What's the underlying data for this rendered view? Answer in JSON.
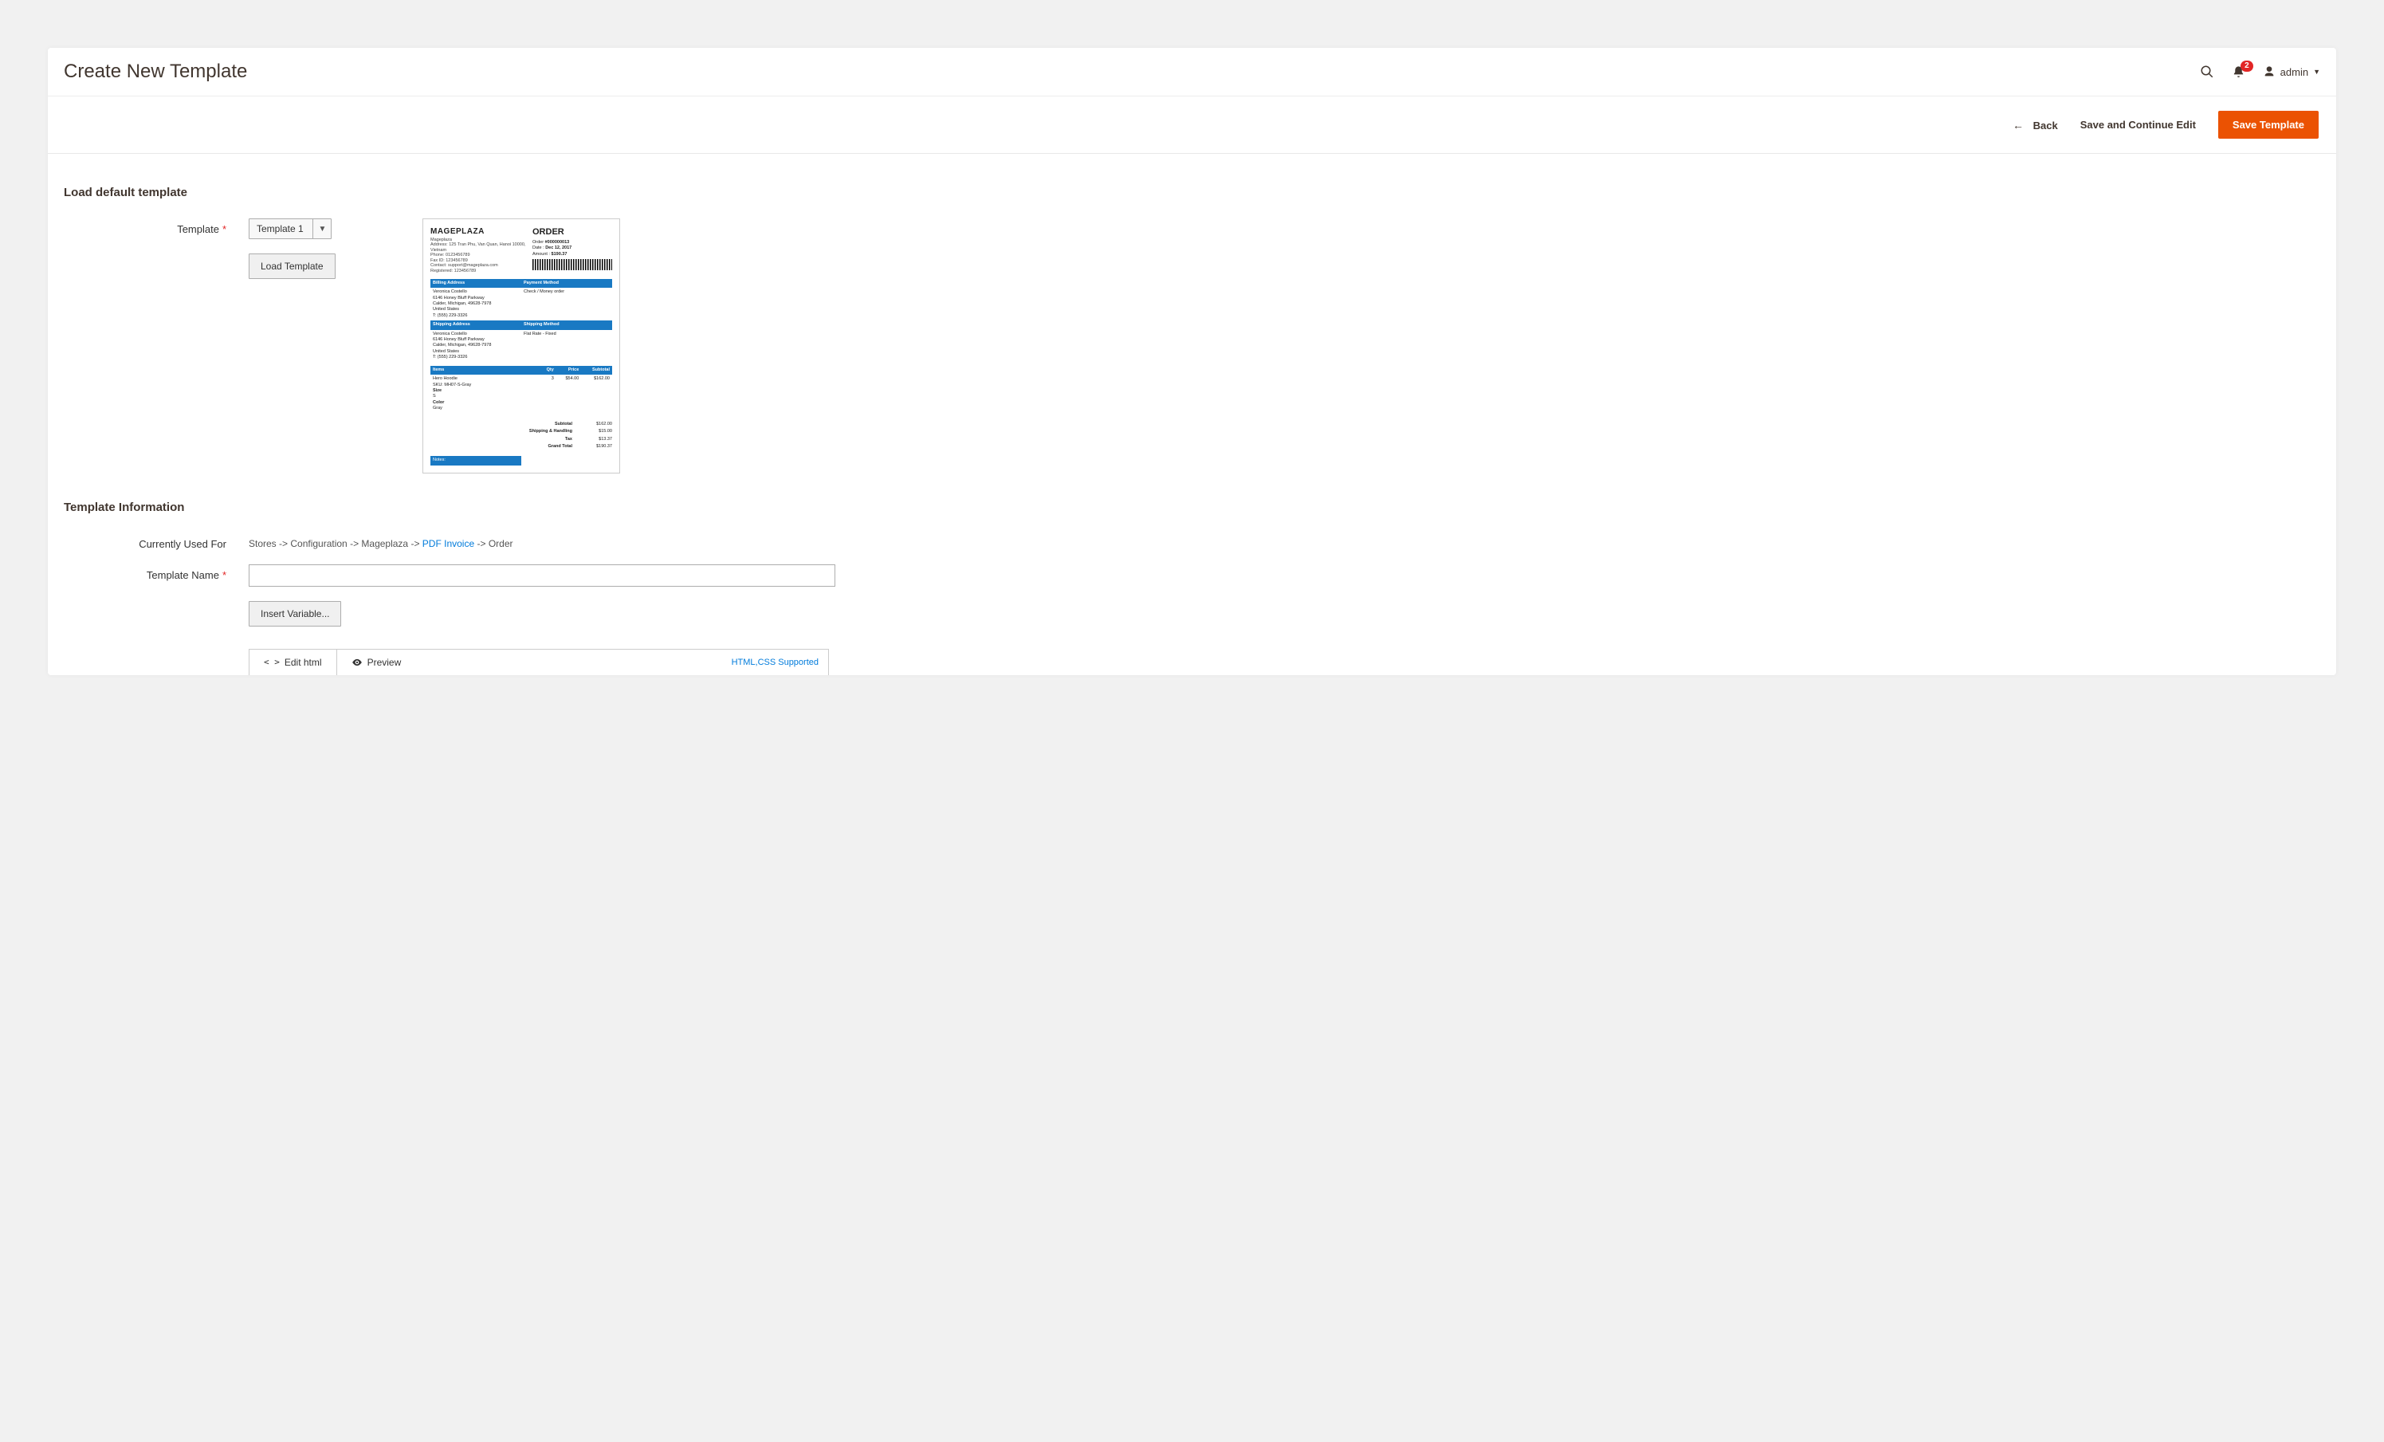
{
  "header": {
    "title": "Create New Template",
    "notification_count": "2",
    "username": "admin"
  },
  "actions": {
    "back": "Back",
    "save_continue": "Save and Continue Edit",
    "save": "Save Template"
  },
  "load_default": {
    "section_title": "Load default template",
    "template_label": "Template",
    "template_options": [
      "Template 1"
    ],
    "selected": "Template 1",
    "load_button": "Load Template"
  },
  "preview": {
    "company": "MAGEPLAZA",
    "comp_name": "Mageplaza",
    "address": "Address: 125 Tran Phu, Van Quan, Hanoi 10000, Vietnam",
    "phone": "Phone: 0123456789",
    "fax": "Fax ID: 123456789",
    "contact": "Contact: support@mageplaza.com",
    "registered": "Registered: 123456789",
    "order_title": "ORDER",
    "order_no_lbl": "Order ",
    "order_no": "#000000013",
    "date_lbl": "Date : ",
    "date": "Dec 12, 2017",
    "amount_lbl": "Amount : ",
    "amount": "$190.37",
    "billing_hdr": "Billing Address",
    "payment_hdr": "Payment Method",
    "cust_name": "Veronica Costello",
    "cust_addr1": "6146 Honey Bluff Parkway",
    "cust_addr2": "Calder, Michigan, 49628-7978",
    "cust_addr3": "United States",
    "cust_phone": "T: (555) 229-3326",
    "payment_method": "Check / Money order",
    "shipping_hdr": "Shipping Address",
    "shipmethod_hdr": "Shipping Method",
    "ship_method": "Flat Rate - Fixed",
    "items_hdr": "Items",
    "qty_hdr": "Qty",
    "price_hdr": "Price",
    "subtotal_hdr": "Subtotal",
    "item_name": "Hero Hoodie",
    "item_sku": "SKU: MH07-S-Gray",
    "item_opt1a": "Size",
    "item_opt1b": "S",
    "item_opt2a": "Color",
    "item_opt2b": "Gray",
    "item_qty": "3",
    "item_price": "$54.00",
    "item_subtotal": "$162.00",
    "tot_sub_lbl": "Subtotal",
    "tot_sub": "$162.00",
    "tot_ship_lbl": "Shipping & Handling",
    "tot_ship": "$15.00",
    "tot_tax_lbl": "Tax",
    "tot_tax": "$13.37",
    "tot_grand_lbl": "Grand Total",
    "tot_grand": "$190.37",
    "notes": "Notes:"
  },
  "info": {
    "section_title": "Template Information",
    "used_for_label": "Currently Used For",
    "breadcrumb": {
      "p1": "Stores -> Configuration -> Mageplaza -> ",
      "link": "PDF Invoice",
      "p2": " -> Order"
    },
    "name_label": "Template Name",
    "name_value": "",
    "insert_variable": "Insert Variable...",
    "edit_html": "Edit html",
    "preview_tab": "Preview",
    "supported_link": "HTML,CSS Supported"
  }
}
